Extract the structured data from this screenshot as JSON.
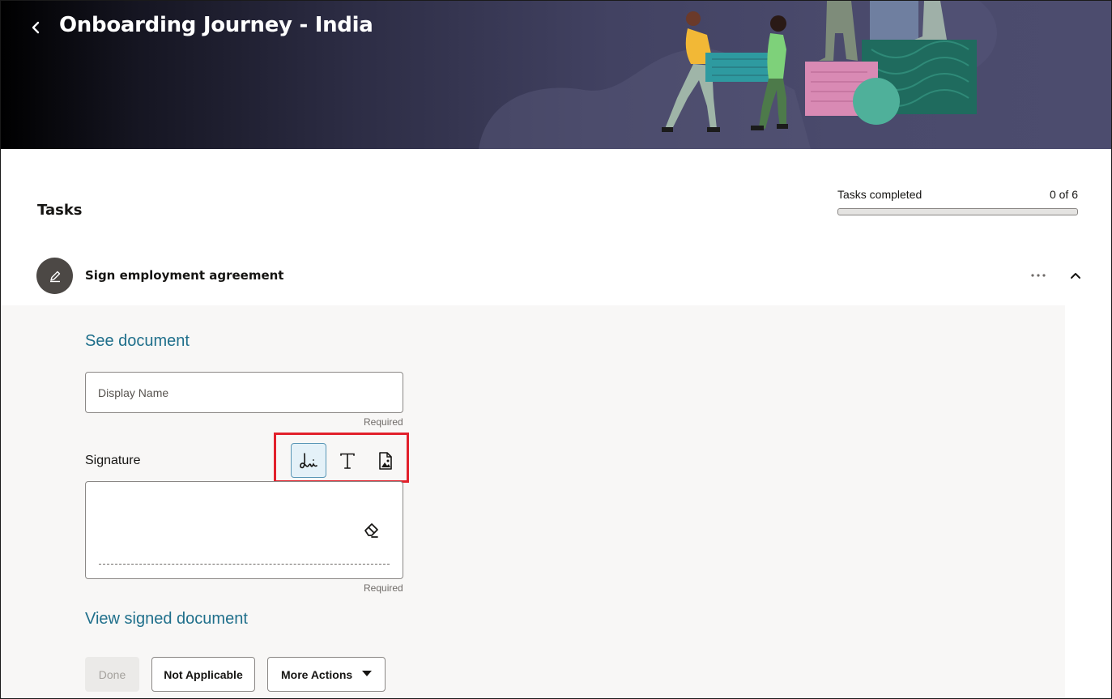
{
  "header": {
    "title": "Onboarding Journey - India",
    "back_icon": "chevron-left-icon"
  },
  "tasks": {
    "title": "Tasks",
    "progress": {
      "label": "Tasks completed",
      "count_text": "0 of 6",
      "completed": 0,
      "total": 6,
      "fraction": 0
    }
  },
  "task": {
    "name": "Sign employment agreement",
    "avatar_icon": "pencil-icon",
    "more_icon": "more-dots-icon",
    "collapse_icon": "chevron-up-icon",
    "see_document_link": "See document",
    "display_name": {
      "placeholder": "Display Name",
      "value": "",
      "helper": "Required"
    },
    "signature": {
      "label": "Signature",
      "modes": [
        {
          "name": "Draw",
          "icon": "signature-draw-icon",
          "selected": true
        },
        {
          "name": "Type",
          "icon": "text-type-icon",
          "selected": false
        },
        {
          "name": "Upload image",
          "icon": "image-file-icon",
          "selected": false
        }
      ],
      "clear_icon": "eraser-icon",
      "helper": "Required"
    },
    "view_signed_link": "View signed document",
    "actions": {
      "done": "Done",
      "not_applicable": "Not Applicable",
      "more_actions": "More Actions"
    }
  },
  "colors": {
    "link": "#1f6f8b",
    "highlight": "#e2202b",
    "selected_mode_bg": "#e4f1f8",
    "panel_bg": "#f8f7f6"
  }
}
